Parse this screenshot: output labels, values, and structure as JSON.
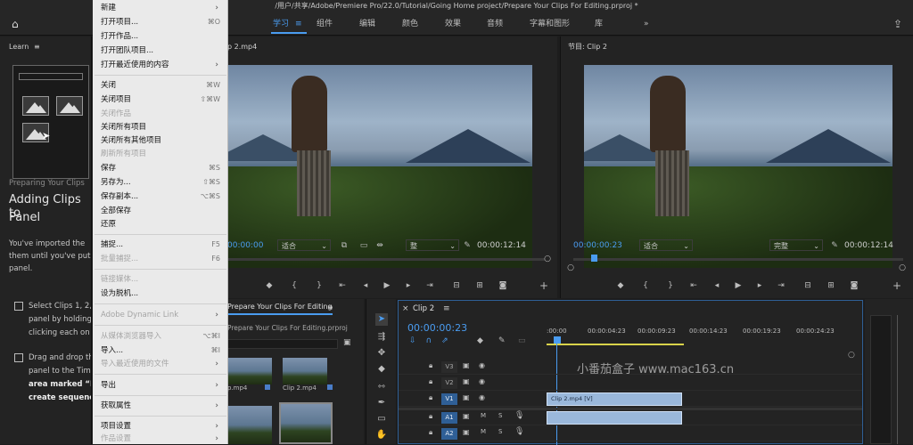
{
  "window": {
    "title_path": "/用户/共享/Adobe/Premiere Pro/22.0/Tutorial/Going Home project/Prepare Your Clips For Editing.prproj *"
  },
  "workspaces": [
    "学习",
    "组件",
    "编辑",
    "颜色",
    "效果",
    "音频",
    "字幕和图形",
    "库"
  ],
  "workspaces_more": "»",
  "learn": {
    "panel_title": "Learn",
    "menu_icon": "≡",
    "breadcrumb": "Preparing Your Clips",
    "heading_line1": "Adding Clips to",
    "heading_line2": "Panel",
    "body_lines": [
      "You've imported the",
      "them until you've put",
      "panel."
    ],
    "step1_lines": [
      "Select Clips 1, 2,",
      "panel by holding",
      "clicking each on"
    ],
    "step2_lines": [
      "Drag and drop the",
      "panel to the Tim",
      "area marked “Dr",
      "create sequence"
    ]
  },
  "menu": {
    "items": [
      {
        "label": "新建",
        "shortcut": "",
        "submenu": true,
        "disabled": false
      },
      {
        "label": "打开项目...",
        "shortcut": "⌘O",
        "submenu": false,
        "disabled": false
      },
      {
        "label": "打开作品...",
        "shortcut": "",
        "submenu": false,
        "disabled": false
      },
      {
        "label": "打开团队项目...",
        "shortcut": "",
        "submenu": false,
        "disabled": false
      },
      {
        "label": "打开最近使用的内容",
        "shortcut": "",
        "submenu": true,
        "disabled": false
      },
      {
        "label": "关闭",
        "shortcut": "⌘W",
        "submenu": false,
        "disabled": false
      },
      {
        "label": "关闭项目",
        "shortcut": "⇧⌘W",
        "submenu": false,
        "disabled": false
      },
      {
        "label": "关闭作品",
        "shortcut": "",
        "submenu": false,
        "disabled": true
      },
      {
        "label": "关闭所有项目",
        "shortcut": "",
        "submenu": false,
        "disabled": false
      },
      {
        "label": "关闭所有其他项目",
        "shortcut": "",
        "submenu": false,
        "disabled": false
      },
      {
        "label": "刷新所有项目",
        "shortcut": "",
        "submenu": false,
        "disabled": true
      },
      {
        "label": "保存",
        "shortcut": "⌘S",
        "submenu": false,
        "disabled": false
      },
      {
        "label": "另存为...",
        "shortcut": "⇧⌘S",
        "submenu": false,
        "disabled": false
      },
      {
        "label": "保存副本...",
        "shortcut": "⌥⌘S",
        "submenu": false,
        "disabled": false
      },
      {
        "label": "全部保存",
        "shortcut": "",
        "submenu": false,
        "disabled": false
      },
      {
        "label": "还原",
        "shortcut": "",
        "submenu": false,
        "disabled": false
      },
      {
        "label": "捕捉...",
        "shortcut": "F5",
        "submenu": false,
        "disabled": false
      },
      {
        "label": "批量捕捉...",
        "shortcut": "F6",
        "submenu": false,
        "disabled": true
      },
      {
        "label": "链接媒体...",
        "shortcut": "",
        "submenu": false,
        "disabled": true
      },
      {
        "label": "设为脱机...",
        "shortcut": "",
        "submenu": false,
        "disabled": false
      },
      {
        "label": "Adobe Dynamic Link",
        "shortcut": "",
        "submenu": true,
        "disabled": true
      },
      {
        "label": "从媒体浏览器导入",
        "shortcut": "⌥⌘I",
        "submenu": false,
        "disabled": true
      },
      {
        "label": "导入...",
        "shortcut": "⌘I",
        "submenu": false,
        "disabled": false
      },
      {
        "label": "导入最近使用的文件",
        "shortcut": "",
        "submenu": true,
        "disabled": true
      },
      {
        "label": "导出",
        "shortcut": "",
        "submenu": true,
        "disabled": false
      },
      {
        "label": "获取属性",
        "shortcut": "",
        "submenu": true,
        "disabled": false
      },
      {
        "label": "项目设置",
        "shortcut": "",
        "submenu": true,
        "disabled": false
      },
      {
        "label": "作品设置",
        "shortcut": "",
        "submenu": true,
        "disabled": true
      }
    ]
  },
  "source": {
    "tab": "p 2.mp4",
    "timecode": "00:00:00",
    "fit": "适合",
    "quality": "整",
    "duration": "00:00:12:14"
  },
  "program": {
    "tab": "节目: Clip 2",
    "timecode": "00:00:00:23",
    "fit": "适合",
    "quality": "完整",
    "duration": "00:00:12:14"
  },
  "project": {
    "tab": "Prepare Your Clips For Editing",
    "file": "Prepare Your Clips For Editing.prproj",
    "clips": [
      "p.mp4",
      "Clip 2.mp4"
    ]
  },
  "timeline": {
    "tab": "Clip 2",
    "timecode": "00:00:00:23",
    "ruler": [
      ":00:00",
      "00:00:04:23",
      "00:00:09:23",
      "00:00:14:23",
      "00:00:19:23",
      "00:00:24:23"
    ],
    "tracks": [
      "V3",
      "V2",
      "V1",
      "A1",
      "A2"
    ],
    "track_buttons": [
      "M",
      "S"
    ],
    "clip_label": "Clip 2.mp4 [V]",
    "watermark": "小番茄盒子 www.mac163.cn"
  },
  "colors": {
    "accent": "#4a9cf0",
    "clip": "#9ab8db",
    "menu_bg": "#eaeaea"
  }
}
